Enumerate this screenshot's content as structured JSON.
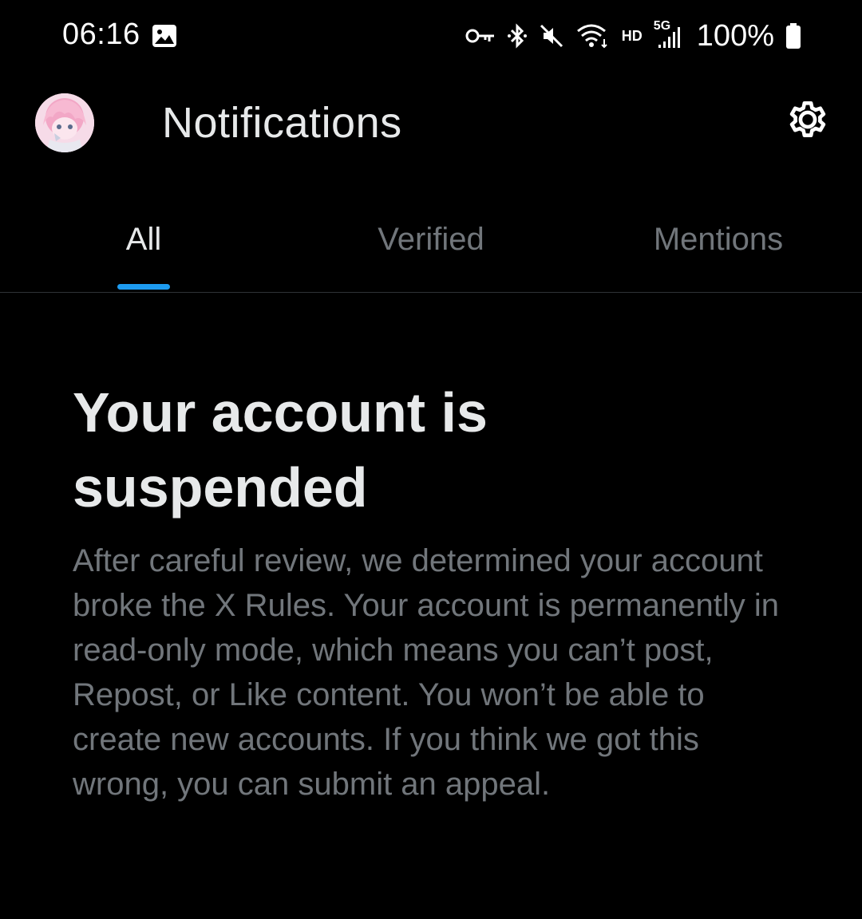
{
  "status_bar": {
    "time": "06:16",
    "network_hd": "HD",
    "network_gen": "5G",
    "battery": "100%",
    "icons": [
      "gallery-icon",
      "key-icon",
      "bluetooth-icon",
      "mute-icon",
      "wifi-icon",
      "signal-icon",
      "battery-icon"
    ]
  },
  "header": {
    "title": "Notifications",
    "avatar_icon": "avatar",
    "settings_icon": "gear-icon"
  },
  "tabs": [
    {
      "label": "All",
      "active": true
    },
    {
      "label": "Verified",
      "active": false
    },
    {
      "label": "Mentions",
      "active": false
    }
  ],
  "colors": {
    "background": "#000000",
    "accent": "#1d9bf0",
    "primary_text": "#e7e9ea",
    "secondary_text": "#71767b",
    "divider": "#2f3336"
  },
  "suspension": {
    "title": "Your account is suspended",
    "body": "After careful review, we determined your account broke the X Rules. Your account is permanently in read-only mode, which means you can’t post, Repost, or Like content. You won’t be able to create new accounts. If you think we got this wrong, you can submit an appeal."
  }
}
